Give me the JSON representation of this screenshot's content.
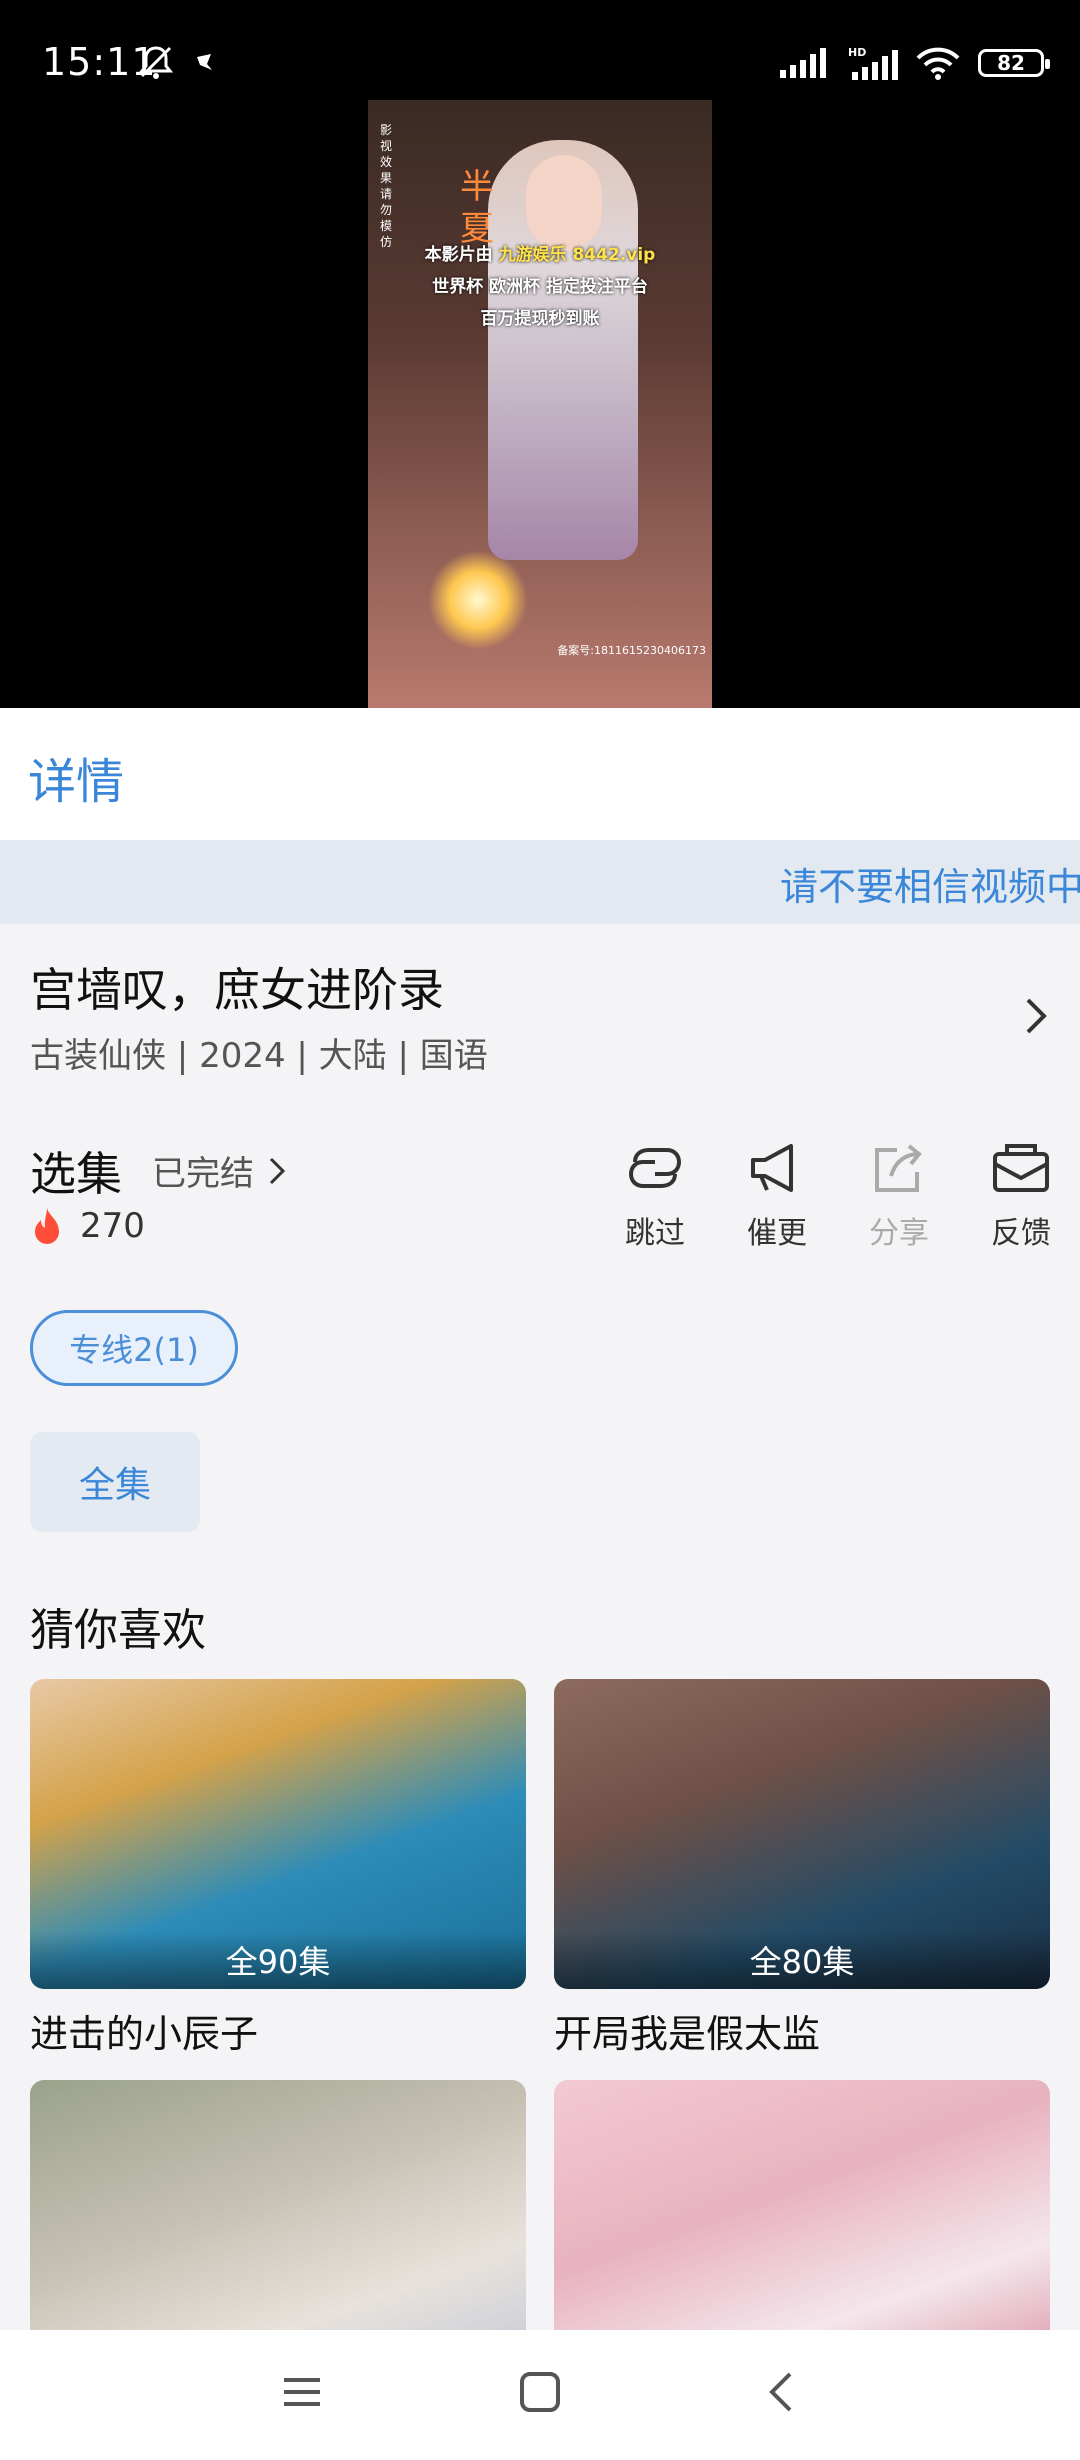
{
  "status_bar": {
    "time": "15:11",
    "battery": "82"
  },
  "video": {
    "vertical_notice": "影视效果请勿模仿",
    "title_calligraphy": "半夏",
    "ad_line1_prefix": "本影片由",
    "ad_line1_highlight": "九游娱乐 8442.vip",
    "ad_line2": "世界杯 欧洲杯 指定投注平台",
    "ad_line3": "百万提现秒到账",
    "registration": "备案号:1811615230406173"
  },
  "tabs": {
    "detail": "详情"
  },
  "notice": {
    "text": "请不要相信视频中的任何广告"
  },
  "show": {
    "title": "宫墙叹，庶女进阶录",
    "meta": "古装仙侠 | 2024 | 大陆 | 国语"
  },
  "episodes": {
    "label": "选集",
    "status": "已完结",
    "heat": "270",
    "line": "专线2(1)",
    "all": "全集"
  },
  "actions": [
    {
      "label": "跳过",
      "icon": "skip-link-icon"
    },
    {
      "label": "催更",
      "icon": "megaphone-icon"
    },
    {
      "label": "分享",
      "icon": "share-icon"
    },
    {
      "label": "反馈",
      "icon": "feedback-mail-icon"
    }
  ],
  "recommend": {
    "title": "猜你喜欢",
    "items": [
      {
        "name": "进击的小辰子",
        "badge": "全90集"
      },
      {
        "name": "开局我是假太监",
        "badge": "全80集"
      },
      {
        "name": "",
        "badge": ""
      },
      {
        "name": "",
        "badge": ""
      }
    ]
  },
  "colors": {
    "accent": "#3a86d8",
    "hot": "#ff4d3a",
    "background": "#f4f4f6"
  }
}
